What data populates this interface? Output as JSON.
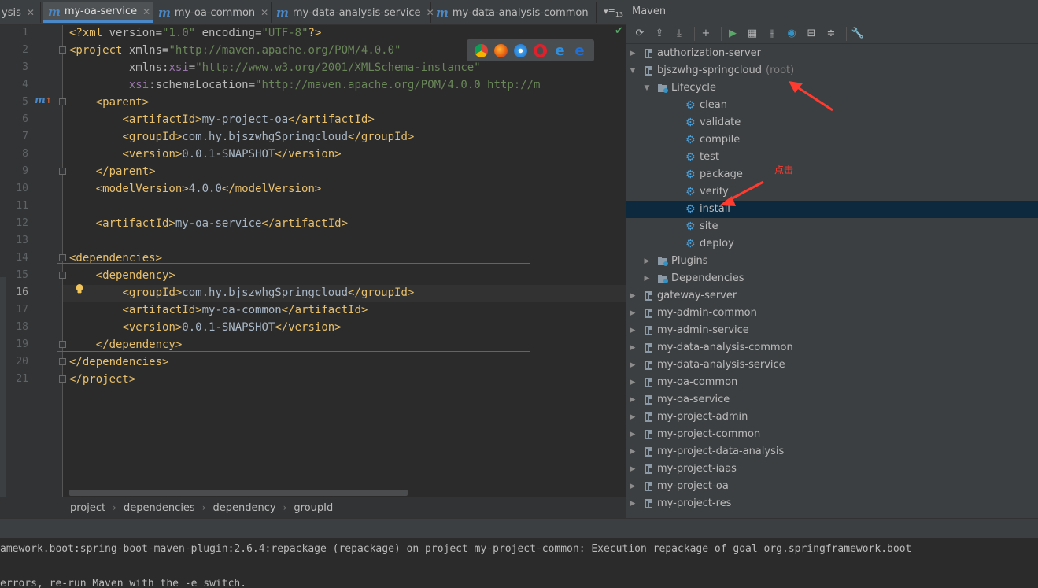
{
  "tabs": [
    {
      "label": "ysis",
      "active": false
    },
    {
      "label": "my-oa-service",
      "active": true
    },
    {
      "label": "my-oa-common",
      "active": false
    },
    {
      "label": "my-data-analysis-service",
      "active": false
    },
    {
      "label": "my-data-analysis-common",
      "active": false
    }
  ],
  "tab_overflow_label": "13",
  "editor": {
    "line_numbers": [
      "1",
      "2",
      "3",
      "4",
      "5",
      "6",
      "7",
      "8",
      "9",
      "10",
      "11",
      "12",
      "13",
      "14",
      "15",
      "16",
      "17",
      "18",
      "19",
      "20",
      "21"
    ],
    "current_line": "16",
    "xml": {
      "decl_open": "<?xml ",
      "decl_version_attr": "version",
      "decl_version_val": "\"1.0\"",
      "decl_encoding_attr": "encoding",
      "decl_encoding_val": "\"UTF-8\"",
      "decl_close": "?>",
      "project_open": "<project ",
      "xmlns_attr": "xmlns",
      "xmlns_val": "\"http://maven.apache.org/POM/4.0.0\"",
      "xmlns_prefix": "xmlns",
      "xsi_ns": "xsi",
      "xsi_val": "\"http://www.w3.org/2001/XMLSchema-instance\"",
      "xsi_prefix": "xsi",
      "schema_attr": "schemaLocation",
      "schema_val": "\"http://maven.apache.org/POM/4.0.0 http://m",
      "parent_open": "<parent>",
      "parent_close": "</parent>",
      "artifact_open": "<artifactId>",
      "artifact_close": "</artifactId>",
      "group_open": "<groupId>",
      "group_close": "</groupId>",
      "version_open": "<version>",
      "version_close": "</version>",
      "model_open": "<modelVersion>",
      "model_close": "</modelVersion>",
      "deps_open": "<dependencies>",
      "deps_close": "</dependencies>",
      "dep_open": "<dependency>",
      "dep_close": "</dependency>",
      "project_close": "</project>",
      "parent_artifact": "my-project-oa",
      "parent_group": "com.hy.bjszwhgSpringcloud",
      "parent_version": "0.0.1-SNAPSHOT",
      "model_version": "4.0.0",
      "artifact": "my-oa-service",
      "dep_group": "com.hy.bjszwhgSpringcloud",
      "dep_artifact": "my-oa-common",
      "dep_version": "0.0.1-SNAPSHOT",
      "eq": "=",
      "colon": ":"
    }
  },
  "breadcrumb": [
    "project",
    "dependencies",
    "dependency",
    "groupId"
  ],
  "maven": {
    "title": "Maven",
    "toolbar": [
      {
        "name": "reimport-icon",
        "glyph": "⟳"
      },
      {
        "name": "generate-sources-icon",
        "glyph": "⇪"
      },
      {
        "name": "download-icon",
        "glyph": "⤓"
      },
      {
        "name": "add-icon",
        "glyph": "+"
      },
      {
        "name": "run-icon",
        "glyph": "▶"
      },
      {
        "name": "run-config-icon",
        "glyph": "▦"
      },
      {
        "name": "toggle-offline-icon",
        "glyph": "⫲"
      },
      {
        "name": "skip-tests-icon",
        "glyph": "◉"
      },
      {
        "name": "show-dependencies-icon",
        "glyph": "⊟"
      },
      {
        "name": "collapse-all-icon",
        "glyph": "≑"
      },
      {
        "name": "settings-icon",
        "glyph": "🔧"
      }
    ],
    "root_suffix": "(root)",
    "tree": [
      {
        "label": "authorization-server",
        "level": 0,
        "arrow": "▶",
        "type": "module"
      },
      {
        "label": "bjszwhg-springcloud",
        "level": 0,
        "arrow": "▼",
        "type": "module",
        "root": true
      },
      {
        "label": "Lifecycle",
        "level": 1,
        "arrow": "▼",
        "type": "folder"
      },
      {
        "label": "clean",
        "level": 2,
        "type": "goal"
      },
      {
        "label": "validate",
        "level": 2,
        "type": "goal"
      },
      {
        "label": "compile",
        "level": 2,
        "type": "goal"
      },
      {
        "label": "test",
        "level": 2,
        "type": "goal"
      },
      {
        "label": "package",
        "level": 2,
        "type": "goal"
      },
      {
        "label": "verify",
        "level": 2,
        "type": "goal"
      },
      {
        "label": "install",
        "level": 2,
        "type": "goal",
        "selected": true
      },
      {
        "label": "site",
        "level": 2,
        "type": "goal"
      },
      {
        "label": "deploy",
        "level": 2,
        "type": "goal"
      },
      {
        "label": "Plugins",
        "level": 1,
        "arrow": "▶",
        "type": "folder"
      },
      {
        "label": "Dependencies",
        "level": 1,
        "arrow": "▶",
        "type": "folder"
      },
      {
        "label": "gateway-server",
        "level": 0,
        "arrow": "▶",
        "type": "module"
      },
      {
        "label": "my-admin-common",
        "level": 0,
        "arrow": "▶",
        "type": "module"
      },
      {
        "label": "my-admin-service",
        "level": 0,
        "arrow": "▶",
        "type": "module"
      },
      {
        "label": "my-data-analysis-common",
        "level": 0,
        "arrow": "▶",
        "type": "module"
      },
      {
        "label": "my-data-analysis-service",
        "level": 0,
        "arrow": "▶",
        "type": "module"
      },
      {
        "label": "my-oa-common",
        "level": 0,
        "arrow": "▶",
        "type": "module"
      },
      {
        "label": "my-oa-service",
        "level": 0,
        "arrow": "▶",
        "type": "module"
      },
      {
        "label": "my-project-admin",
        "level": 0,
        "arrow": "▶",
        "type": "module"
      },
      {
        "label": "my-project-common",
        "level": 0,
        "arrow": "▶",
        "type": "module"
      },
      {
        "label": "my-project-data-analysis",
        "level": 0,
        "arrow": "▶",
        "type": "module"
      },
      {
        "label": "my-project-iaas",
        "level": 0,
        "arrow": "▶",
        "type": "module"
      },
      {
        "label": "my-project-oa",
        "level": 0,
        "arrow": "▶",
        "type": "module"
      },
      {
        "label": "my-project-res",
        "level": 0,
        "arrow": "▶",
        "type": "module"
      }
    ]
  },
  "annotation": {
    "click_label": "点击",
    "color": "#ff3b30"
  },
  "console": {
    "line1": "amework.boot:spring-boot-maven-plugin:2.6.4:repackage (repackage) on project my-project-common: Execution repackage of goal org.springframework.boot",
    "line2": "errors, re-run Maven with the -e switch."
  },
  "colors": {
    "accent": "#4a88c7",
    "selection": "#0d293e",
    "tag": "#e8bf6a",
    "string": "#6a8759",
    "namespace": "#9876aa"
  }
}
